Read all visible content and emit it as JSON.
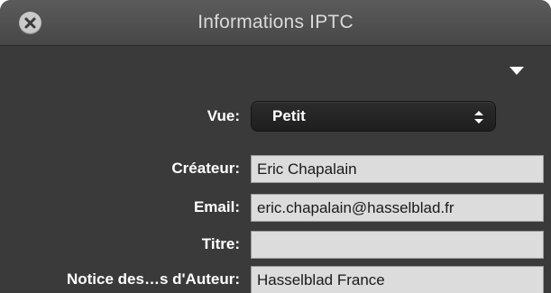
{
  "window": {
    "title": "Informations IPTC"
  },
  "view_selector": {
    "label": "Vue:",
    "selected": "Petit"
  },
  "fields": [
    {
      "label": "Créateur:",
      "value": "Eric Chapalain"
    },
    {
      "label": "Email:",
      "value": "eric.chapalain@hasselblad.fr"
    },
    {
      "label": "Titre:",
      "value": ""
    },
    {
      "label": "Notice des…s d'Auteur:",
      "value": "Hasselblad France"
    }
  ],
  "icons": {
    "close": "close-icon",
    "disclosure": "triangle-down-icon",
    "popup": "up-down-arrows-icon"
  }
}
